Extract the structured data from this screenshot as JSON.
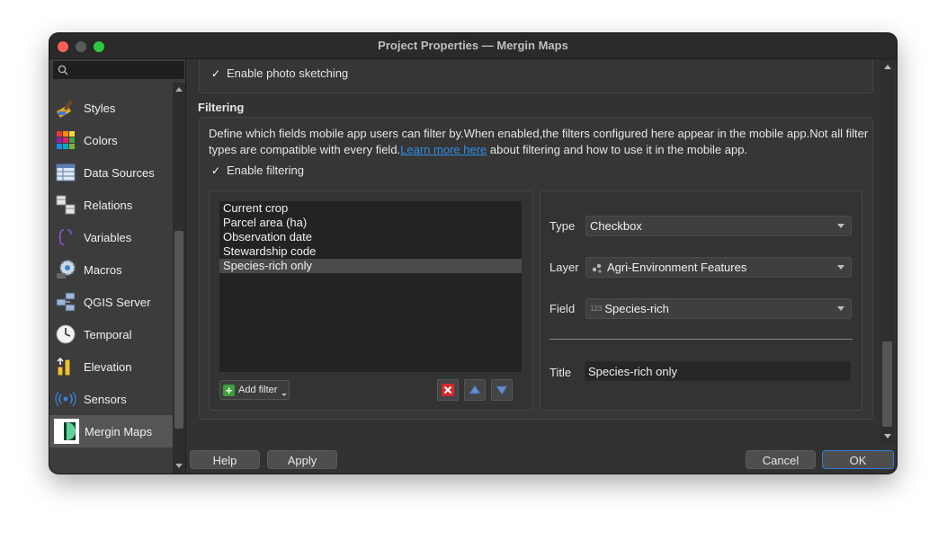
{
  "window": {
    "title": "Project Properties — Mergin Maps"
  },
  "sidebar": {
    "items": [
      {
        "label": "Styles",
        "icon": "styles-icon"
      },
      {
        "label": "Colors",
        "icon": "colors-icon"
      },
      {
        "label": "Data Sources",
        "icon": "data-sources-icon"
      },
      {
        "label": "Relations",
        "icon": "relations-icon"
      },
      {
        "label": "Variables",
        "icon": "variables-icon"
      },
      {
        "label": "Macros",
        "icon": "macros-icon"
      },
      {
        "label": "QGIS Server",
        "icon": "qgis-server-icon"
      },
      {
        "label": "Temporal",
        "icon": "temporal-icon"
      },
      {
        "label": "Elevation",
        "icon": "elevation-icon"
      },
      {
        "label": "Sensors",
        "icon": "sensors-icon"
      },
      {
        "label": "Mergin Maps",
        "icon": "mergin-maps-icon",
        "active": true
      }
    ]
  },
  "photo": {
    "checkbox_label": "Enable photo sketching",
    "checked": true
  },
  "filtering": {
    "section_title": "Filtering",
    "desc_before": "Define which fields mobile app users can filter by.When enabled,the filters configured here appear in the mobile app.Not all filter types are compatible with every field.",
    "desc_link": "Learn more here",
    "desc_after": " about filtering and how to use it in the mobile app.",
    "enable_label": "Enable filtering",
    "enabled": true,
    "filters": [
      "Current crop",
      "Parcel area (ha)",
      "Observation date",
      "Stewardship code",
      "Species-rich only"
    ],
    "selected_index": 4,
    "add_filter_label": "Add filter"
  },
  "props": {
    "type_label": "Type",
    "type_value": "Checkbox",
    "layer_label": "Layer",
    "layer_value": "Agri-Environment Features",
    "field_label": "Field",
    "field_prefix": "123",
    "field_value": "Species-rich",
    "title_label": "Title",
    "title_value": "Species-rich only"
  },
  "buttons": {
    "help": "Help",
    "apply": "Apply",
    "cancel": "Cancel",
    "ok": "OK"
  },
  "colors": {
    "accent": "#2f8fe6",
    "remove": "#d9262b",
    "move": "#6b8fc9"
  }
}
